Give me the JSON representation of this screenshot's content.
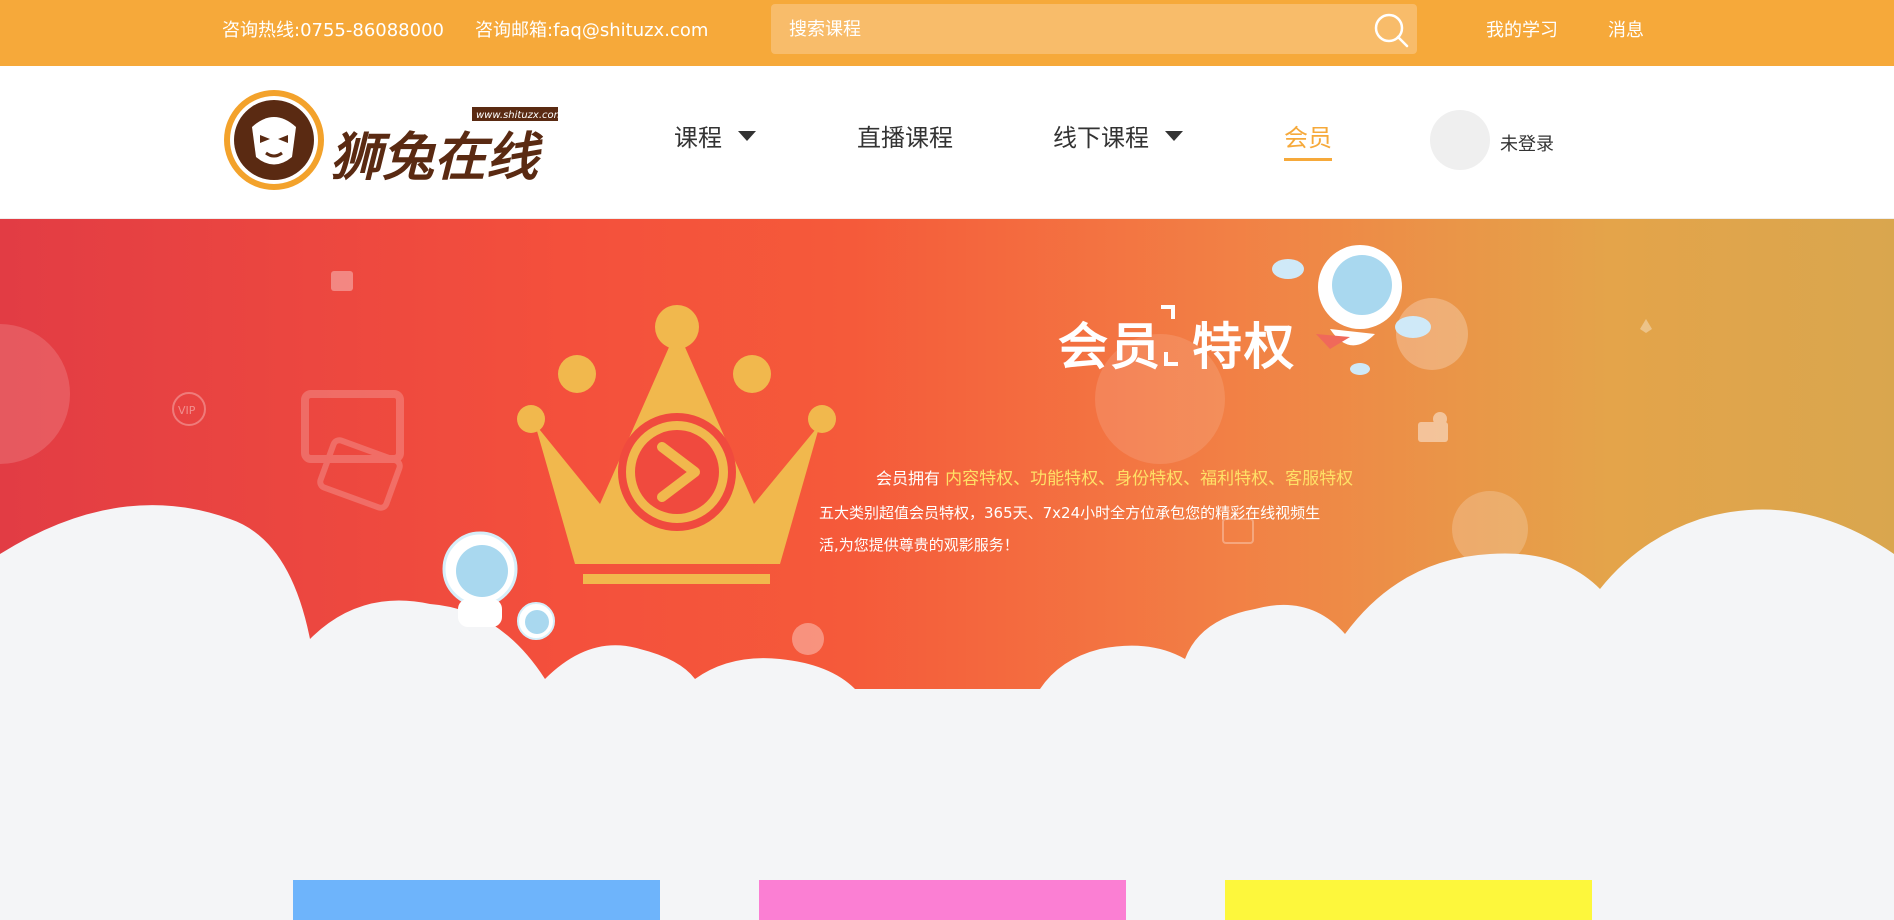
{
  "topbar": {
    "phone": "咨询热线:0755-86088000",
    "email": "咨询邮箱:faq@shituzx.com",
    "search_placeholder": "搜索课程",
    "my_learning": "我的学习",
    "messages": "消息"
  },
  "header": {
    "logo_text": "狮兔在线",
    "logo_url_text": "www.shituzx.com",
    "nav": {
      "courses": "课程",
      "live": "直播课程",
      "offline": "线下课程",
      "member": "会员"
    },
    "login_status": "未登录"
  },
  "banner": {
    "title_part1": "会员",
    "title_part2": "特权",
    "vip_badge": "VIP",
    "desc_prefix": "会员拥有",
    "desc_highlight": "内容特权、功能特权、身份特权、福利特权、客服特权",
    "desc_body": "五大类别超值会员特权，365天、7x24小时全方位承包您的精彩在线视频生活,为您提供尊贵的观影服务！"
  },
  "colors": {
    "brand_orange": "#f6a93a",
    "card_blue": "#6eb4fb",
    "card_pink": "#fb7fd3",
    "card_yellow": "#fdf73c"
  }
}
